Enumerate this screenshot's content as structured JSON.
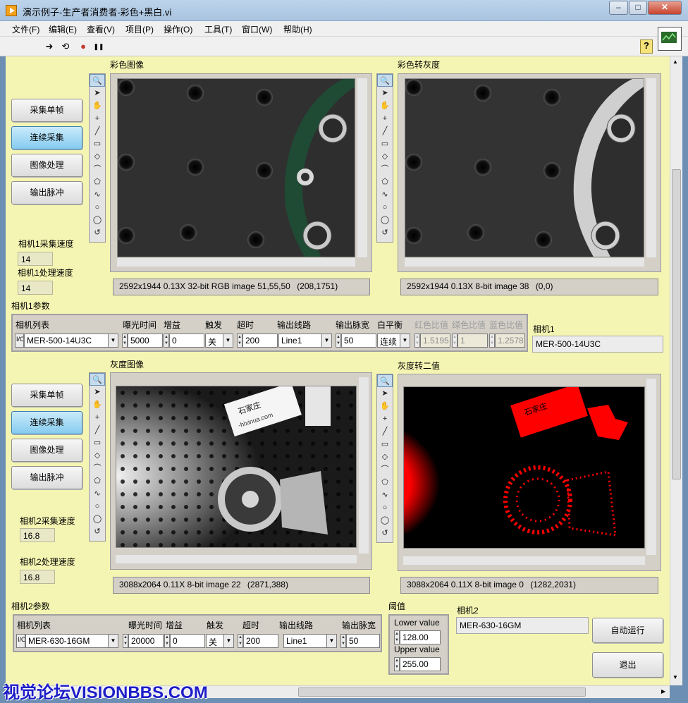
{
  "window": {
    "title": "演示例子-生产者消费者-彩色+黑白.vi",
    "minimize": "–",
    "maximize": "□",
    "close": "✕"
  },
  "menu": [
    "文件(F)",
    "编辑(E)",
    "查看(V)",
    "项目(P)",
    "操作(O)",
    "工具(T)",
    "窗口(W)",
    "帮助(H)"
  ],
  "toolbar": {
    "run": "➜",
    "run_cont": "⟲",
    "abort": "●",
    "pause": "❚❚",
    "help": "?"
  },
  "cam1": {
    "buttons": [
      "采集单帧",
      "连续采集",
      "图像处理",
      "输出脉冲"
    ],
    "acq_speed_label": "相机1采集速度",
    "acq_speed": "14",
    "proc_speed_label": "相机1处理速度",
    "proc_speed": "14",
    "color_title": "彩色图像",
    "color_status": [
      "2592x1944 0.13X 32-bit RGB image 51,55,50",
      "(208,1751)"
    ],
    "gray_title": "彩色转灰度",
    "gray_status": [
      "2592x1944 0.13X 8-bit image 38",
      "(0,0)"
    ],
    "params_label": "相机1参数",
    "headers": [
      "相机列表",
      "曝光时间",
      "增益",
      "触发",
      "超时",
      "输出线路",
      "输出脉宽",
      "白平衡",
      "红色比值",
      "绿色比值",
      "蓝色比值"
    ],
    "camera": "MER-500-14U3C",
    "exposure": "5000",
    "gain": "0",
    "trigger": "关",
    "timeout": "200",
    "line": "Line1",
    "pulse": "50",
    "wb": "连续",
    "red": "1.5195",
    "green": "1",
    "blue": "1.2578",
    "name_label": "相机1",
    "name": "MER-500-14U3C"
  },
  "cam2": {
    "buttons": [
      "采集单帧",
      "连续采集",
      "图像处理",
      "输出脉冲"
    ],
    "acq_speed_label": "相机2采集速度",
    "acq_speed": "16.8",
    "proc_speed_label": "相机2处理速度",
    "proc_speed": "16.8",
    "gray_title": "灰度图像",
    "gray_status": [
      "3088x2064 0.11X 8-bit image 22",
      "(2871,388)"
    ],
    "bin_title": "灰度转二值",
    "bin_status": [
      "3088x2064 0.11X 8-bit image 0",
      "(1282,2031)"
    ],
    "params_label": "相机2参数",
    "headers": [
      "相机列表",
      "曝光时间",
      "增益",
      "触发",
      "超时",
      "输出线路",
      "输出脉宽"
    ],
    "camera": "MER-630-16GM",
    "exposure": "20000",
    "gain": "0",
    "trigger": "关",
    "timeout": "200",
    "line": "Line1",
    "pulse": "50",
    "threshold_label": "阈值",
    "lower_label": "Lower value",
    "lower": "128.00",
    "upper_label": "Upper value",
    "upper": "255.00",
    "name_label": "相机2",
    "name": "MER-630-16GM"
  },
  "auto_run": "自动运行",
  "exit": "退出",
  "card_text": [
    "石家庄",
    "-hixinua.com"
  ],
  "watermark": "视觉论坛VISIONBBS.COM",
  "colors": {
    "panel": "#f5f5b3",
    "active_button": "#86cbef",
    "binary_red": "#ff0000"
  }
}
